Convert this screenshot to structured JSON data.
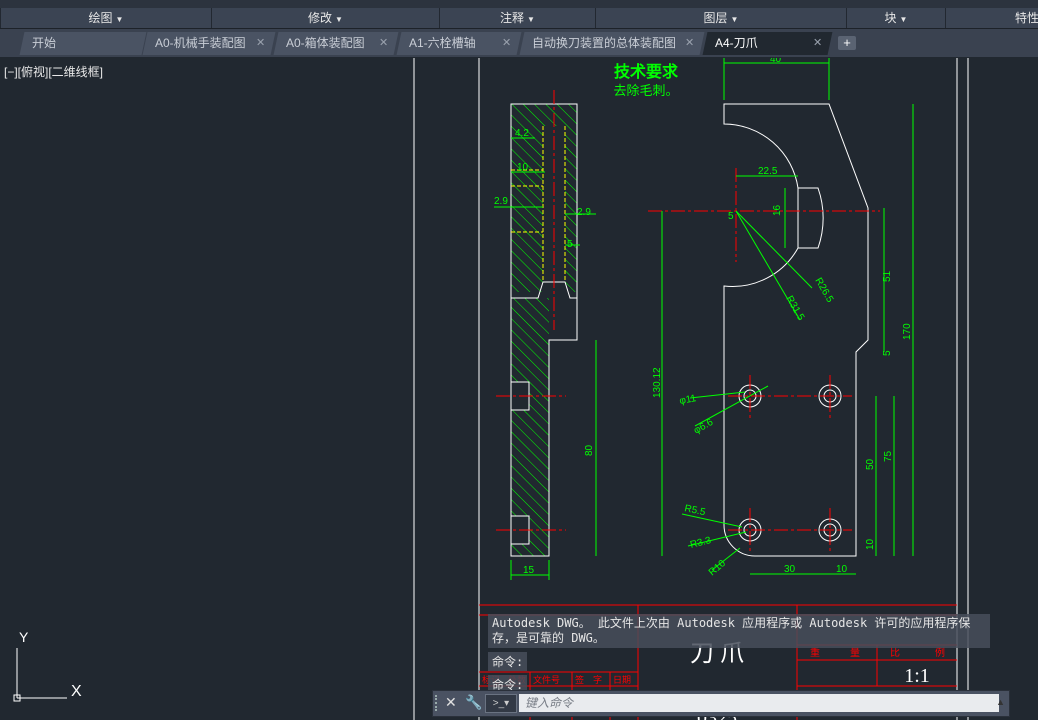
{
  "ribbon": {
    "panels": [
      "绘图",
      "修改",
      "注释",
      "图层",
      "块",
      "特性"
    ]
  },
  "tabs": [
    {
      "label": "开始",
      "closable": false,
      "active": false
    },
    {
      "label": "A0-机械手装配图",
      "closable": true,
      "active": false
    },
    {
      "label": "A0-箱体装配图",
      "closable": true,
      "active": false
    },
    {
      "label": "A1-六栓槽轴",
      "closable": true,
      "active": false
    },
    {
      "label": "自动换刀装置的总体装配图",
      "closable": true,
      "active": false
    },
    {
      "label": "A4-刀爪",
      "closable": true,
      "active": true
    }
  ],
  "viewport": {
    "label": "[−][俯视][二维线框]"
  },
  "ucs": {
    "x_label": "X",
    "y_label": "Y"
  },
  "drawing": {
    "tech_title": "技术要求",
    "tech_note": "去除毛刺。",
    "dims_left": [
      "4.2",
      "10",
      "2.9",
      "2.9",
      "5",
      "80",
      "15"
    ],
    "dims_right": [
      "40",
      "22.5",
      "5",
      "16",
      "R26.5",
      "R31.5",
      "51",
      "5",
      "170",
      "130.12",
      "φ11",
      "φ6.6",
      "50",
      "75",
      "R5.5",
      "R3.3",
      "R10",
      "30",
      "10",
      "10"
    ],
    "title_block": {
      "part_name": "刀  爪",
      "scale": "1:1",
      "drawing_no": "0325",
      "headers": [
        "重",
        "量",
        "比",
        "例"
      ],
      "sub_headers": [
        "标记",
        "处数",
        "文件号",
        "签",
        "字",
        "日期"
      ]
    }
  },
  "command": {
    "message": "Autodesk DWG。 此文件上次由 Autodesk 应用程序或 Autodesk 许可的应用程序保存，是可靠的 DWG。",
    "history": [
      "命令:",
      "命令:"
    ],
    "placeholder": "键入命令"
  },
  "colors": {
    "background": "#212830",
    "outline": "#ffffff",
    "dimension": "#00ff00",
    "centerline": "#ff0000",
    "hidden": "#ffff00"
  }
}
